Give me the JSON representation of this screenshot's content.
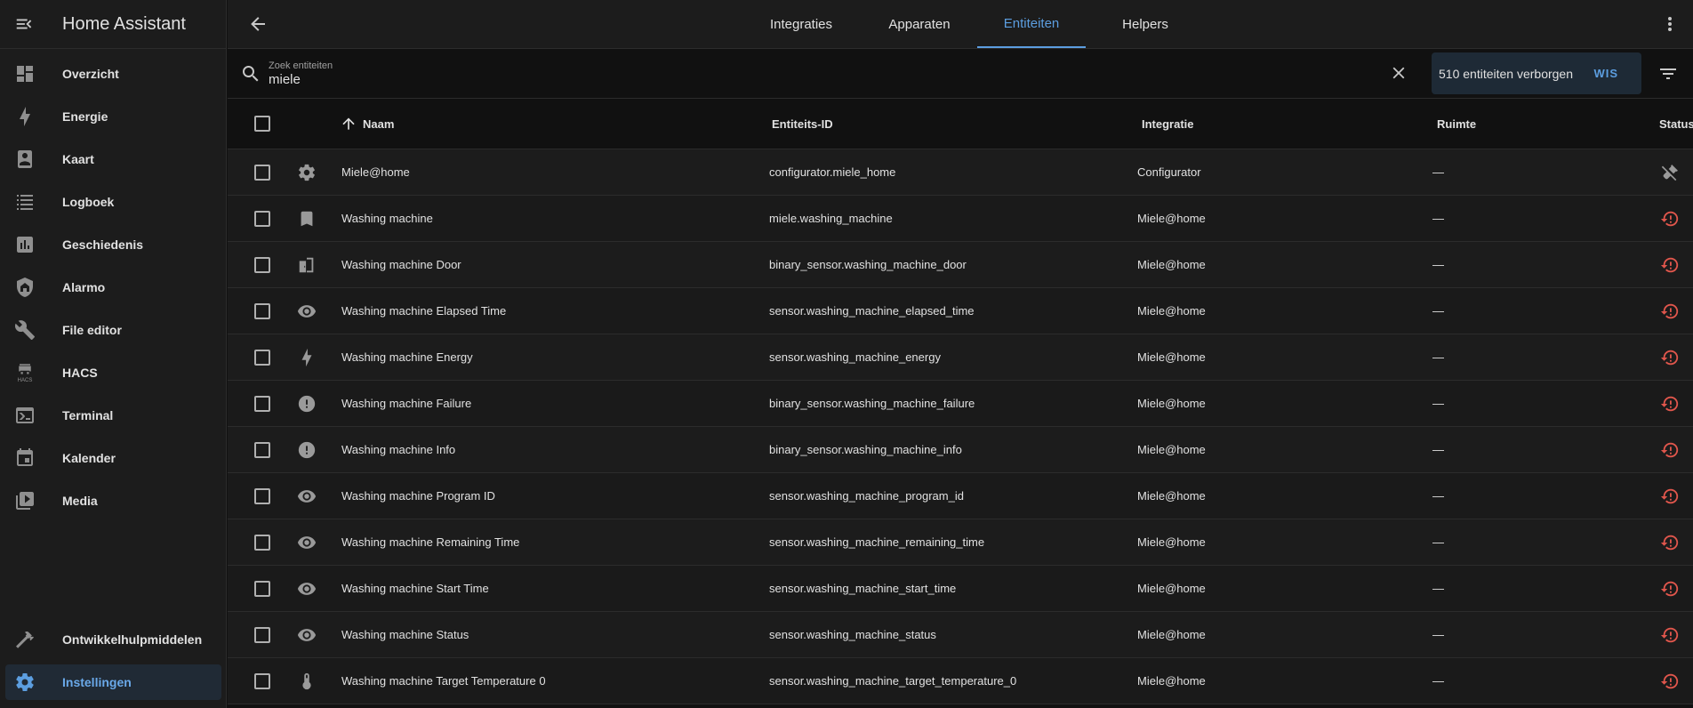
{
  "app": {
    "title": "Home Assistant"
  },
  "sidebar": {
    "items": [
      {
        "label": "Overzicht",
        "icon": "dashboard-icon"
      },
      {
        "label": "Energie",
        "icon": "lightning-icon"
      },
      {
        "label": "Kaart",
        "icon": "map-icon"
      },
      {
        "label": "Logboek",
        "icon": "list-icon"
      },
      {
        "label": "Geschiedenis",
        "icon": "chart-icon"
      },
      {
        "label": "Alarmo",
        "icon": "shield-home-icon"
      },
      {
        "label": "File editor",
        "icon": "wrench-icon"
      },
      {
        "label": "HACS",
        "icon": "hacs-icon"
      },
      {
        "label": "Terminal",
        "icon": "console-icon"
      },
      {
        "label": "Kalender",
        "icon": "calendar-icon"
      },
      {
        "label": "Media",
        "icon": "media-icon"
      }
    ],
    "bottom": [
      {
        "label": "Ontwikkelhulpmiddelen",
        "icon": "hammer-icon"
      },
      {
        "label": "Instellingen",
        "icon": "gear-icon",
        "active": true
      }
    ],
    "hacs_text": "HACS"
  },
  "tabs": [
    {
      "label": "Integraties"
    },
    {
      "label": "Apparaten"
    },
    {
      "label": "Entiteiten",
      "active": true
    },
    {
      "label": "Helpers"
    }
  ],
  "search": {
    "label": "Zoek entiteiten",
    "value": "miele",
    "hidden_count_text": "510 entiteiten verborgen",
    "clear_label": "WIS"
  },
  "table": {
    "columns": {
      "name": "Naam",
      "entity_id": "Entiteits-ID",
      "integration": "Integratie",
      "area": "Ruimte",
      "status": "Status"
    },
    "rows": [
      {
        "icon": "gear-icon",
        "name": "Miele@home",
        "entity_id": "configurator.miele_home",
        "integration": "Configurator",
        "area": "—",
        "status": "readonly-icon"
      },
      {
        "icon": "bookmark-icon",
        "name": "Washing machine",
        "entity_id": "miele.washing_machine",
        "integration": "Miele@home",
        "area": "—",
        "status": "restore-alert-icon"
      },
      {
        "icon": "door-icon",
        "name": "Washing machine Door",
        "entity_id": "binary_sensor.washing_machine_door",
        "integration": "Miele@home",
        "area": "—",
        "status": "restore-alert-icon"
      },
      {
        "icon": "eye-icon",
        "name": "Washing machine Elapsed Time",
        "entity_id": "sensor.washing_machine_elapsed_time",
        "integration": "Miele@home",
        "area": "—",
        "status": "restore-alert-icon"
      },
      {
        "icon": "lightning-icon",
        "name": "Washing machine Energy",
        "entity_id": "sensor.washing_machine_energy",
        "integration": "Miele@home",
        "area": "—",
        "status": "restore-alert-icon"
      },
      {
        "icon": "alert-circle-icon",
        "name": "Washing machine Failure",
        "entity_id": "binary_sensor.washing_machine_failure",
        "integration": "Miele@home",
        "area": "—",
        "status": "restore-alert-icon"
      },
      {
        "icon": "alert-circle-icon",
        "name": "Washing machine Info",
        "entity_id": "binary_sensor.washing_machine_info",
        "integration": "Miele@home",
        "area": "—",
        "status": "restore-alert-icon"
      },
      {
        "icon": "eye-icon",
        "name": "Washing machine Program ID",
        "entity_id": "sensor.washing_machine_program_id",
        "integration": "Miele@home",
        "area": "—",
        "status": "restore-alert-icon"
      },
      {
        "icon": "eye-icon",
        "name": "Washing machine Remaining Time",
        "entity_id": "sensor.washing_machine_remaining_time",
        "integration": "Miele@home",
        "area": "—",
        "status": "restore-alert-icon"
      },
      {
        "icon": "eye-icon",
        "name": "Washing machine Start Time",
        "entity_id": "sensor.washing_machine_start_time",
        "integration": "Miele@home",
        "area": "—",
        "status": "restore-alert-icon"
      },
      {
        "icon": "eye-icon",
        "name": "Washing machine Status",
        "entity_id": "sensor.washing_machine_status",
        "integration": "Miele@home",
        "area": "—",
        "status": "restore-alert-icon"
      },
      {
        "icon": "thermometer-icon",
        "name": "Washing machine Target Temperature 0",
        "entity_id": "sensor.washing_machine_target_temperature_0",
        "integration": "Miele@home",
        "area": "—",
        "status": "restore-alert-icon"
      }
    ]
  },
  "colors": {
    "accent": "#5c9ee0",
    "status_alert": "#e0564c"
  }
}
